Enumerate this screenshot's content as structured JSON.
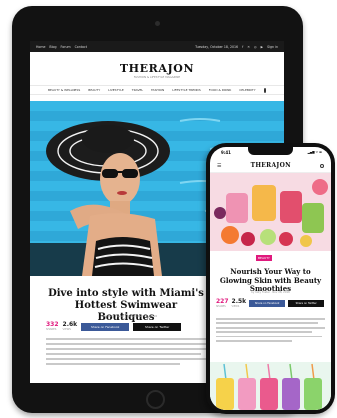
{
  "tablet": {
    "topbar": {
      "nav": [
        "Home",
        "Blog",
        "Forum",
        "Contact"
      ],
      "date": "Tuesday, October 18, 2016",
      "social": [
        "f",
        "✕",
        "◎",
        "▶"
      ],
      "login": "Sign in"
    },
    "logo": "THERAJON",
    "tagline": "FASHION & LIFESTYLE MAGAZINE",
    "menu": [
      "BEAUTY & WELLNESS",
      "BEAUTY",
      "LIVESTYLE",
      "TRAVEL",
      "FASHION",
      "LIFESTYLE TRENDS",
      "FOOD & DRINK",
      "CELEBRITY"
    ],
    "article": {
      "title": "Dive into style with Miami's Hottest Swimwear Boutiques",
      "meta": "by Katy Foster  ·  November 28, 2016",
      "shares_count": "332",
      "shares_label": "SHARES",
      "views_count": "2.6k",
      "views_label": "VIEWS",
      "facebook_label": "Share on Facebook",
      "twitter_label": "Share on Twitter"
    }
  },
  "phone": {
    "time": "9:41",
    "status": "▂▄▆ ᯤ ▬",
    "menu_icon": "☰",
    "logo": "THERAJON",
    "article": {
      "category": "BEAUTY",
      "title": "Nourish Your Way to Glowing Skin with Beauty Smoothies",
      "meta": "by Katy Foster  ·  Nov 28, 2016",
      "shares_count": "227",
      "shares_label": "SHARES",
      "views_count": "2.5k",
      "views_label": "VIEWS",
      "facebook_label": "Share on Facebook",
      "twitter_label": "Share on Twitter"
    }
  },
  "colors": {
    "accent": "#e0197d",
    "facebook": "#3b5998",
    "dark": "#111111"
  }
}
